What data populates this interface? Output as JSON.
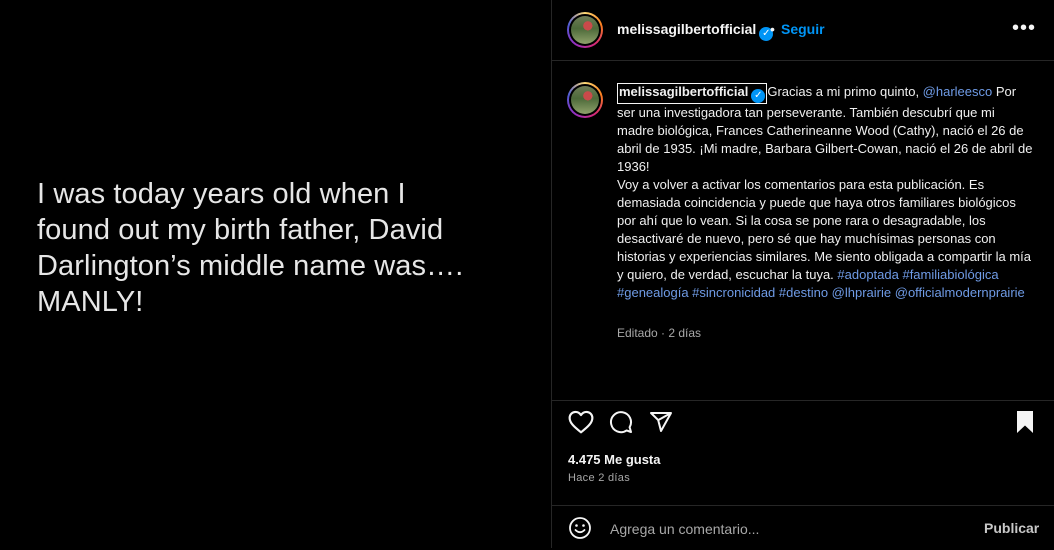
{
  "media": {
    "text": "I was today years old when I\nfound out my birth father, David\nDarlington’s middle name was….\nMANLY!"
  },
  "header": {
    "username": "melissagilbertofficial",
    "separator": "•",
    "follow_label": "Seguir",
    "more_label": "•••"
  },
  "caption": {
    "username": "melissagilbertofficial",
    "intro": "Gracias a mi primo quinto, ",
    "mention_1": "@harleesco",
    "body_1": " Por ser una investigadora tan perseverante. También descubrí que mi madre biológica, Frances Catherineanne Wood (Cathy), nació el 26 de abril de 1935. ¡Mi madre, Barbara Gilbert-Cowan, nació el 26 de abril de 1936!",
    "body_2": "Voy a volver a activar los comentarios para esta publicación. Es demasiada coincidencia y puede que haya otros familiares biológicos por ahí que lo vean. Si la cosa se pone rara o desagradable, los desactivaré de nuevo, pero sé que hay muchísimas personas con historias y experiencias similares. Me siento obligada a compartir la mía y quiero, de verdad, escuchar la tuya. ",
    "hashtags": "#adoptada #familiabiológica #genealogía #sincronicidad #destino",
    "mention_2": "@lhprairie",
    "mention_3": "@officialmodernprairie",
    "meta": "Editado  ·  2 días"
  },
  "actions": {
    "likes": "4.475 Me gusta",
    "time": "Hace 2 días"
  },
  "comment": {
    "placeholder": "Agrega un comentario...",
    "publish_label": "Publicar"
  },
  "colors": {
    "background": "#000000",
    "link": "#6f9be6",
    "follow": "#0095f6",
    "verified": "#0095f6"
  },
  "icons": [
    "heart-icon",
    "comment-icon",
    "share-icon",
    "bookmark-icon",
    "emoji-icon",
    "verified-icon",
    "more-icon"
  ]
}
